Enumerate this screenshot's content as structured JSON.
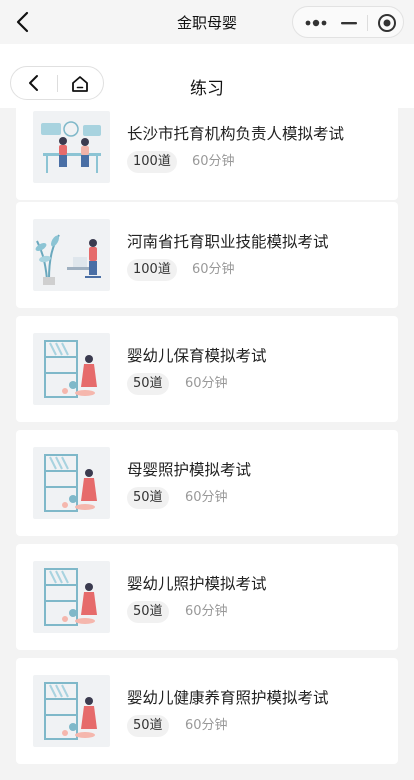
{
  "topbar": {
    "title": "金职母婴"
  },
  "page": {
    "title": "练习"
  },
  "exams": [
    {
      "title": "长沙市托育机构负责人模拟考试",
      "count": "100道",
      "duration": "60分钟",
      "image": "office-meeting-illustration"
    },
    {
      "title": "河南省托育职业技能模拟考试",
      "count": "100道",
      "duration": "60分钟",
      "image": "woman-laptop-plant-illustration"
    },
    {
      "title": "婴幼儿保育模拟考试",
      "count": "50道",
      "duration": "60分钟",
      "image": "mother-baby-shelf-illustration"
    },
    {
      "title": "母婴照护模拟考试",
      "count": "50道",
      "duration": "60分钟",
      "image": "mother-baby-shelf-illustration"
    },
    {
      "title": "婴幼儿照护模拟考试",
      "count": "50道",
      "duration": "60分钟",
      "image": "mother-baby-shelf-illustration"
    },
    {
      "title": "婴幼儿健康养育照护模拟考试",
      "count": "50道",
      "duration": "60分钟",
      "image": "mother-baby-shelf-illustration"
    }
  ]
}
